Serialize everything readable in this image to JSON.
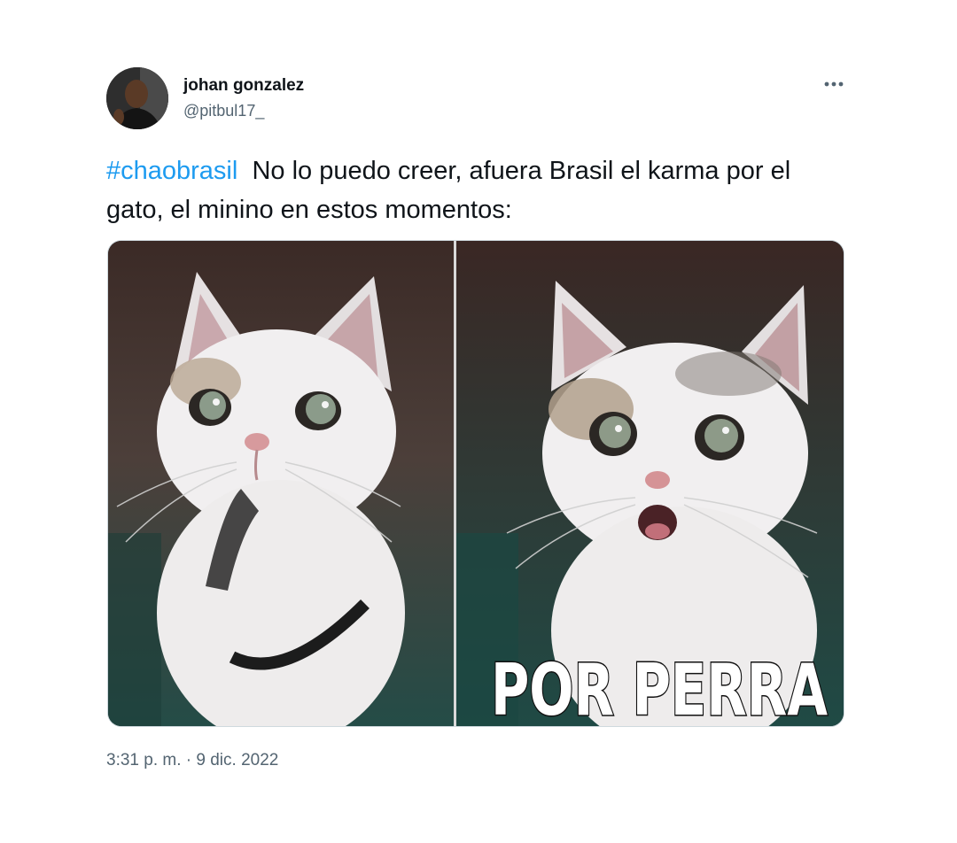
{
  "author": {
    "display_name": "johan gonzalez",
    "handle": "@pitbul17_"
  },
  "tweet": {
    "hashtag": "#chaobrasil",
    "text": "No lo puedo creer, afuera Brasil el karma por el gato, el minino en estos momentos:",
    "timestamp": "3:31 p. m. · 9 dic. 2022"
  },
  "media": {
    "caption": "POR PERRA"
  },
  "icons": {
    "more": "more-horizontal-icon"
  },
  "colors": {
    "link": "#1d9bf0",
    "text": "#0f1419",
    "secondary": "#536471"
  }
}
